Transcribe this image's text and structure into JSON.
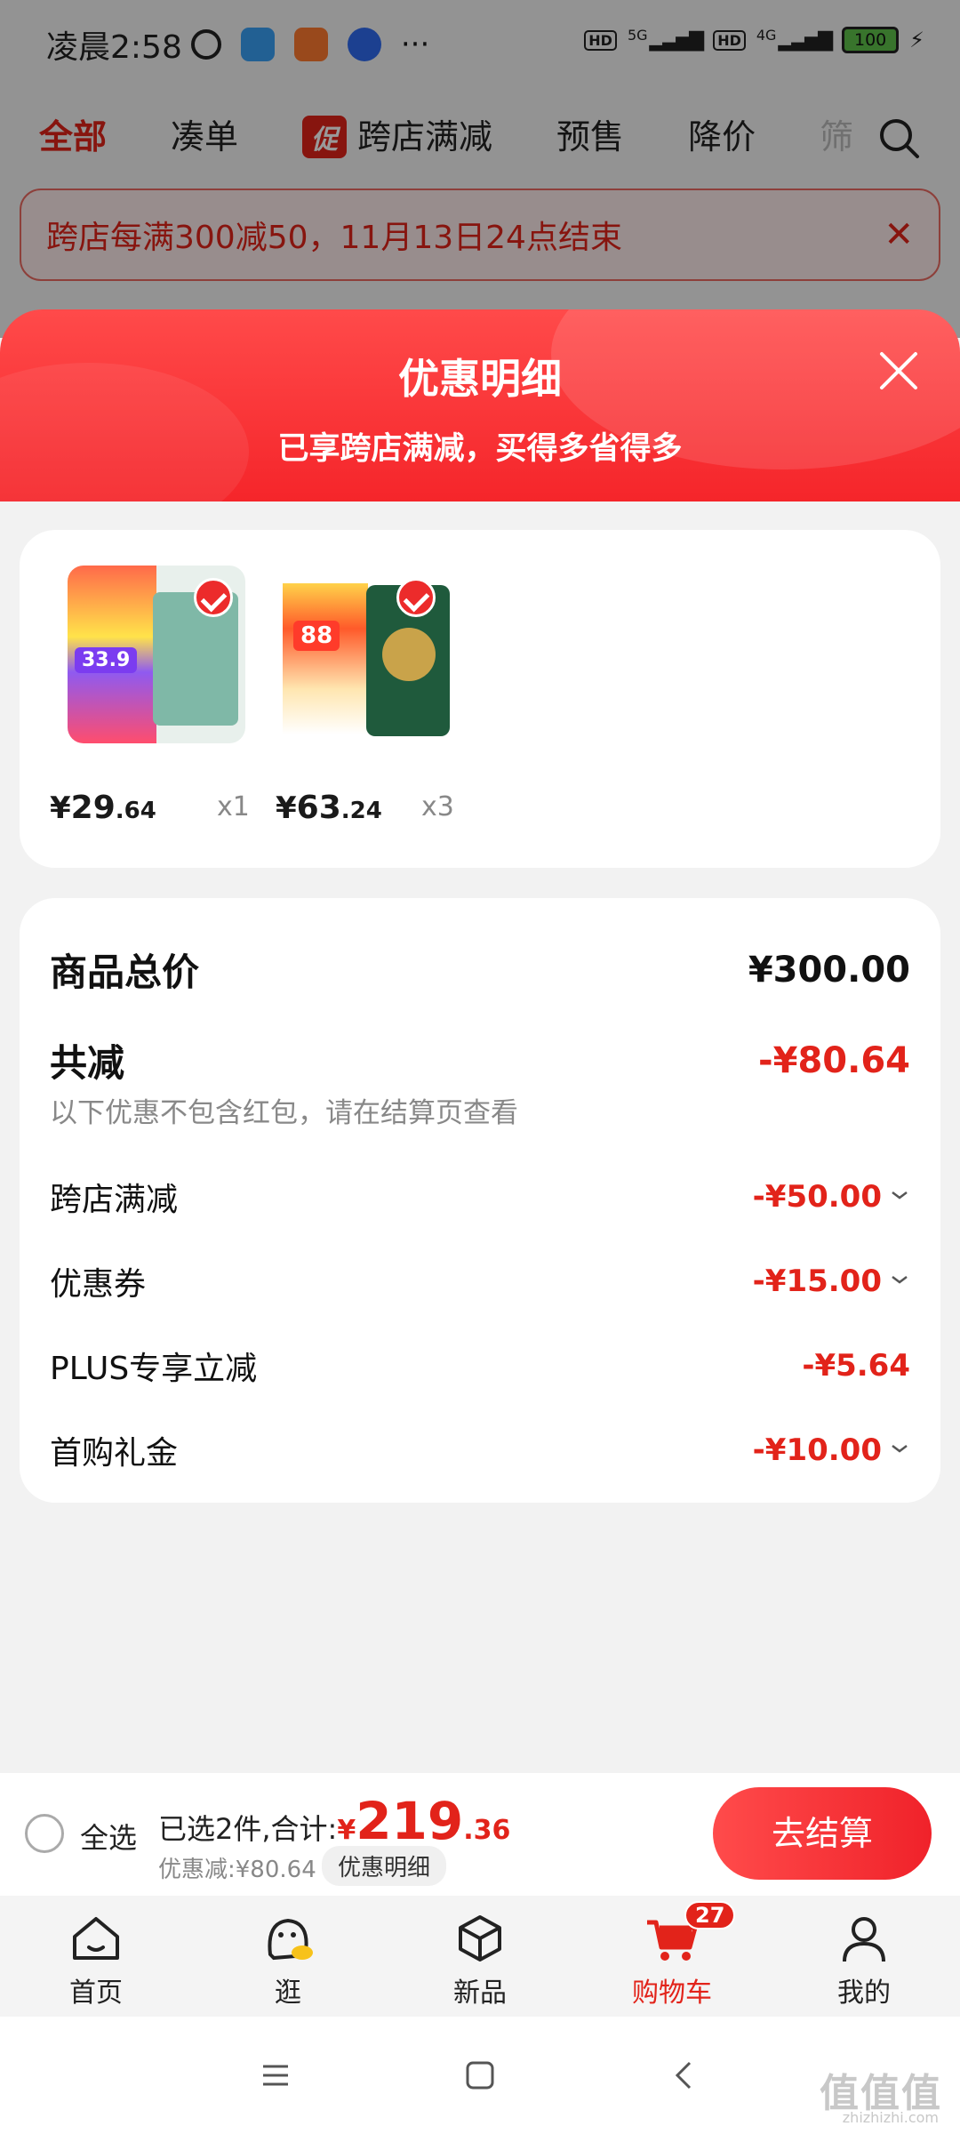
{
  "status_bar": {
    "time": "凌晨2:58",
    "more": "···",
    "hd1": "HD",
    "net1": "5G",
    "hd2": "HD",
    "net2": "4G",
    "battery": "100"
  },
  "top_tabs": [
    {
      "label": "全部",
      "active": true
    },
    {
      "label": "凑单"
    },
    {
      "label": "跨店满减",
      "chip": "促"
    },
    {
      "label": "预售"
    },
    {
      "label": "降价"
    },
    {
      "label": "筛"
    }
  ],
  "notice": {
    "text": "跨店每满300减50，11月13日24点结束"
  },
  "sheet": {
    "title": "优惠明细",
    "subtitle": "已享跨店满减，买得多省得多"
  },
  "products": [
    {
      "price_symbol": "¥",
      "price_int": "29",
      "price_dec": ".64",
      "qty": "x1",
      "image_badge": "33.9"
    },
    {
      "price_symbol": "¥",
      "price_int": "63",
      "price_dec": ".24",
      "qty": "x3",
      "image_badge": "88"
    }
  ],
  "summary": {
    "total_label": "商品总价",
    "total_value": "¥300.00",
    "discount_label": "共减",
    "discount_value": "-¥80.64",
    "note": "以下优惠不包含红包，请在结算页查看",
    "items": [
      {
        "label": "跨店满减",
        "value": "-¥50.00",
        "expandable": true
      },
      {
        "label": "优惠券",
        "value": "-¥15.00",
        "expandable": true
      },
      {
        "label": "PLUS专享立减",
        "value": "-¥5.64",
        "expandable": false
      },
      {
        "label": "首购礼金",
        "value": "-¥10.00",
        "expandable": true
      }
    ]
  },
  "checkout": {
    "select_all": "全选",
    "selected_text": "已选2件,合计:",
    "total_symbol": "¥",
    "total_int": "219",
    "total_dec": ".36",
    "discount_text": "优惠减:¥80.64",
    "detail_button": "优惠明细",
    "checkout_button": "去结算"
  },
  "tabbar": [
    {
      "label": "首页",
      "icon": "home-icon"
    },
    {
      "label": "逛",
      "icon": "browse-icon"
    },
    {
      "label": "新品",
      "icon": "cube-icon"
    },
    {
      "label": "购物车",
      "icon": "cart-icon",
      "active": true,
      "badge": "27"
    },
    {
      "label": "我的",
      "icon": "user-icon"
    }
  ],
  "watermark": {
    "text": "值值值",
    "sub": "zhizhizhi.com"
  },
  "colors": {
    "accent": "#e2231a",
    "header_gradient_top": "#ff4a4a",
    "header_gradient_bottom": "#f5252a"
  }
}
